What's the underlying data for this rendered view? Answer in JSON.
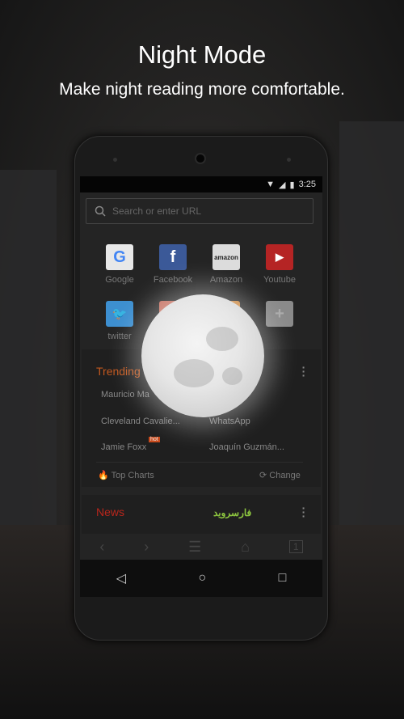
{
  "header": {
    "title": "Night Mode",
    "subtitle": "Make night reading more comfortable."
  },
  "status_bar": {
    "time": "3:25"
  },
  "search": {
    "placeholder": "Search or enter URL"
  },
  "speed_dial": [
    {
      "label": "Google",
      "icon": "google-icon",
      "color": "#e8e8e8"
    },
    {
      "label": "Facebook",
      "icon": "facebook-icon",
      "color": "#3b5998"
    },
    {
      "label": "Amazon",
      "icon": "amazon-icon",
      "color": "#dcdcdc"
    },
    {
      "label": "Youtube",
      "icon": "youtube-icon",
      "color": "#b52424"
    },
    {
      "label": "twitter",
      "icon": "twitter-icon",
      "color": "#3d8fd0"
    },
    {
      "label": "",
      "icon": "site-icon",
      "color": "#c26a5a"
    },
    {
      "label": "",
      "icon": "site-icon",
      "color": "#c9843c"
    },
    {
      "label": "",
      "icon": "plus-icon",
      "color": "#8a8a8a"
    }
  ],
  "trending": {
    "title": "Trending",
    "items": [
      "Mauricio Ma",
      "WhatsApp",
      "Cleveland Cavalie...",
      "Jamie Foxx",
      "Joaquín Guzmán..."
    ],
    "hot_badge": "hot",
    "top_charts": "Top Charts",
    "change": "Change",
    "accent": "#c2581f"
  },
  "news": {
    "title": "News",
    "accent": "#b8261c",
    "watermark": "فارسروید"
  }
}
